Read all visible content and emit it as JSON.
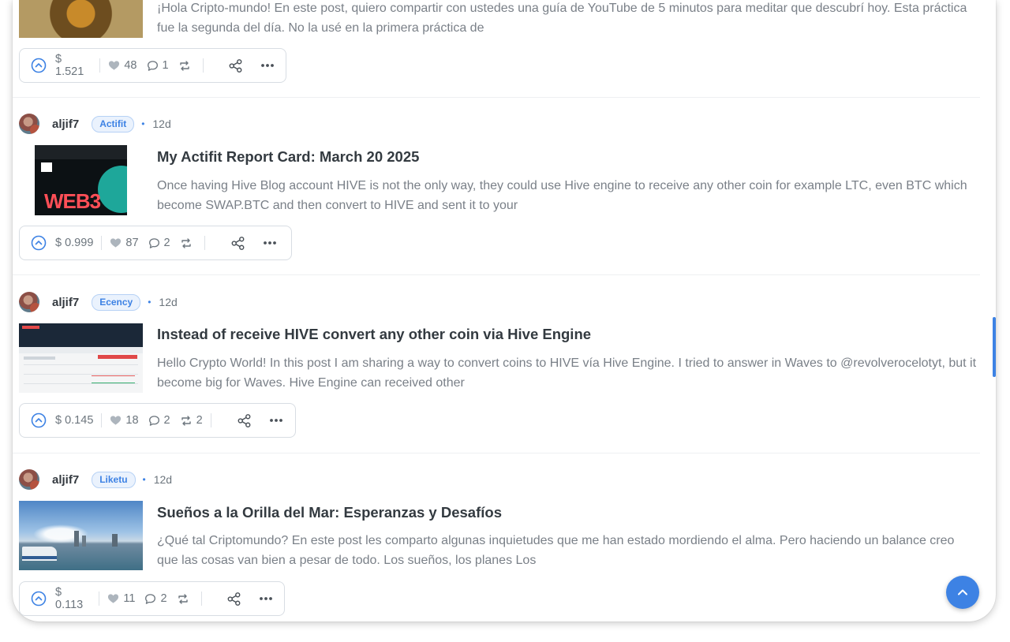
{
  "posts": [
    {
      "author": "",
      "community": "",
      "time": "",
      "title": "",
      "excerpt": "¡Hola Cripto-mundo! En este post, quiero compartir con ustedes una guía de YouTube de 5 minutos para meditar que descubrí hoy. Esta práctica fue la segunda del día. No la usé en la primera práctica de",
      "payout": "$ 1.521",
      "votes": "48",
      "comments": "1",
      "reblogs": ""
    },
    {
      "author": "aljif7",
      "community": "Actifit",
      "time": "12d",
      "title": "My Actifit Report Card: March 20 2025",
      "excerpt": "Once having Hive Blog account HIVE is not the only way, they could use Hive engine to receive any other coin for example LTC, even BTC which become SWAP.BTC and then convert to HIVE and sent it to your",
      "payout": "$ 0.999",
      "votes": "87",
      "comments": "2",
      "reblogs": "",
      "thumb_text": "WEB3"
    },
    {
      "author": "aljif7",
      "community": "Ecency",
      "time": "12d",
      "title": "Instead of receive HIVE convert any other coin via Hive Engine",
      "excerpt": "Hello Crypto World! In this post I am sharing a way to convert coins to HIVE vía Hive Engine. I tried to answer in Waves to @revolverocelotyt, but it become big for Waves. Hive Engine can received other",
      "payout": "$ 0.145",
      "votes": "18",
      "comments": "2",
      "reblogs": "2"
    },
    {
      "author": "aljif7",
      "community": "Liketu",
      "time": "12d",
      "title": "Sueños a la Orilla del Mar: Esperanzas y Desafíos",
      "excerpt": "¿Qué tal Criptomundo? En este post les comparto algunas inquietudes que me han estado mordiendo el alma. Pero haciendo un balance creo que las cosas van bien a pesar de todo. Los sueños, los planes Los",
      "payout": "$ 0.113",
      "votes": "11",
      "comments": "2",
      "reblogs": ""
    }
  ],
  "icons": {
    "upvote": "chevron-up-circle-icon",
    "heart": "heart-icon",
    "comment": "comment-icon",
    "reblog": "reblog-icon",
    "share": "share-icon",
    "more": "more-dots-icon",
    "scroll_top": "arrow-up-icon"
  },
  "colors": {
    "accent": "#3d82e4",
    "badge_bg": "#eaf2fd",
    "muted_text": "#7a8088"
  }
}
